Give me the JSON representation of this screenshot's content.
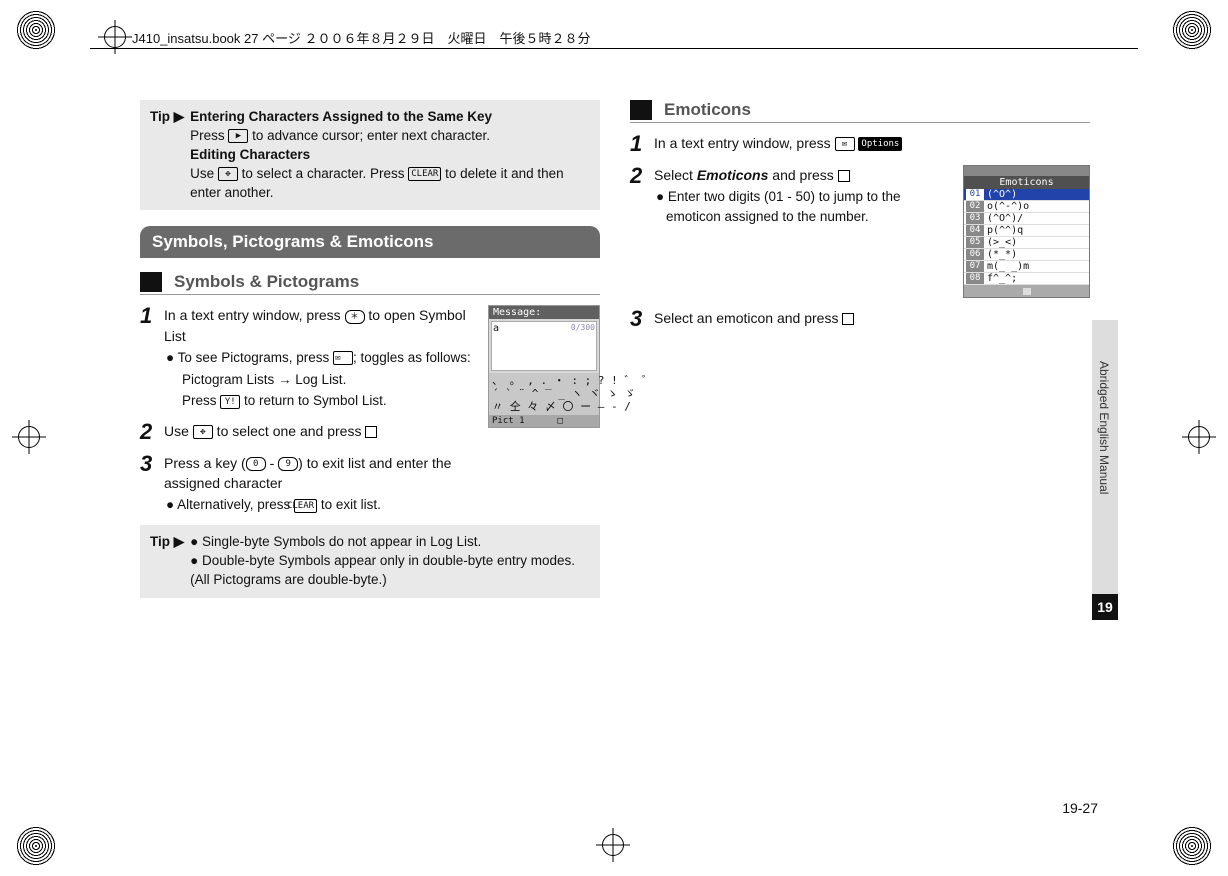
{
  "header": {
    "text": "J410_insatsu.book  27 ページ  ２００６年８月２９日　火曜日　午後５時２８分"
  },
  "tip1": {
    "label": "Tip ▶",
    "bold1": "Entering Characters Assigned to the Same Key",
    "line1a": "Press ",
    "line1b": " to advance cursor; enter next character.",
    "bold2": "Editing Characters",
    "line2a": "Use ",
    "line2b": " to select a character. Press ",
    "line2c": " to delete it and then enter another."
  },
  "section1": "Symbols, Pictograms & Emoticons",
  "sub1": "Symbols & Pictograms",
  "left_steps": {
    "s1a": "In a text entry window, press ",
    "s1b": " to open Symbol List",
    "s1c": "To see Pictograms, press ",
    "s1d": "; toggles as follows:",
    "s1e": "Pictogram Lists → Log List.",
    "s1f": "Press ",
    "s1g": " to return to Symbol List.",
    "s2a": "Use ",
    "s2b": " to select one and press ",
    "s3a": "Press a key (",
    "s3b": " - ",
    "s3c": ") to exit list and enter the assigned character",
    "s3d": "Alternatively, press ",
    "s3e": " to exit list."
  },
  "tip2": {
    "label": "Tip ▶",
    "b1": "Single-byte Symbols do not appear in Log List.",
    "b2": "Double-byte Symbols appear only in double-byte entry modes. (All Pictograms are double-byte.)"
  },
  "screenshot1": {
    "title": "Message:",
    "body": "a",
    "counter": "0/300",
    "grid1": "、 。 , . ・ : ; ? ! ゛ ゜",
    "grid2": "´ ` ¨ ^ ‾ _ ヽ ヾ ゝ ゞ",
    "grid3": "〃 仝 々 〆 〇 ー ― ‐ /",
    "footer_left": "Pict 1",
    "footer_mid": "□"
  },
  "sub2": "Emoticons",
  "right_steps": {
    "s1a": "In a text entry window, press ",
    "s1b": " ",
    "options_label": "Options",
    "s2a": "Select ",
    "s2b": "Emoticons",
    "s2c": " and press ",
    "s2d": "Enter two digits (01 - 50) to jump to the emoticon assigned to the number.",
    "s3a": "Select an emoticon and press "
  },
  "emoticons_shot": {
    "title": "Emoticons",
    "rows": [
      {
        "idx": "01",
        "val": "(^O^)"
      },
      {
        "idx": "02",
        "val": "o(^-^)o"
      },
      {
        "idx": "03",
        "val": "(^O^)/"
      },
      {
        "idx": "04",
        "val": "p(^^)q"
      },
      {
        "idx": "05",
        "val": "(>_<)"
      },
      {
        "idx": "06",
        "val": "(*_*)"
      },
      {
        "idx": "07",
        "val": "m(_ _)m"
      },
      {
        "idx": "08",
        "val": "f^_^;"
      }
    ]
  },
  "sidebar": {
    "label": "Abridged English Manual",
    "num": "19"
  },
  "page_number": "19-27",
  "keys": {
    "advance": "▶",
    "nav": "✥",
    "clear": "CLEAR",
    "star": "＊",
    "mail": "✉",
    "yahoo": "Y!",
    "zero": "0",
    "nine": "9"
  }
}
